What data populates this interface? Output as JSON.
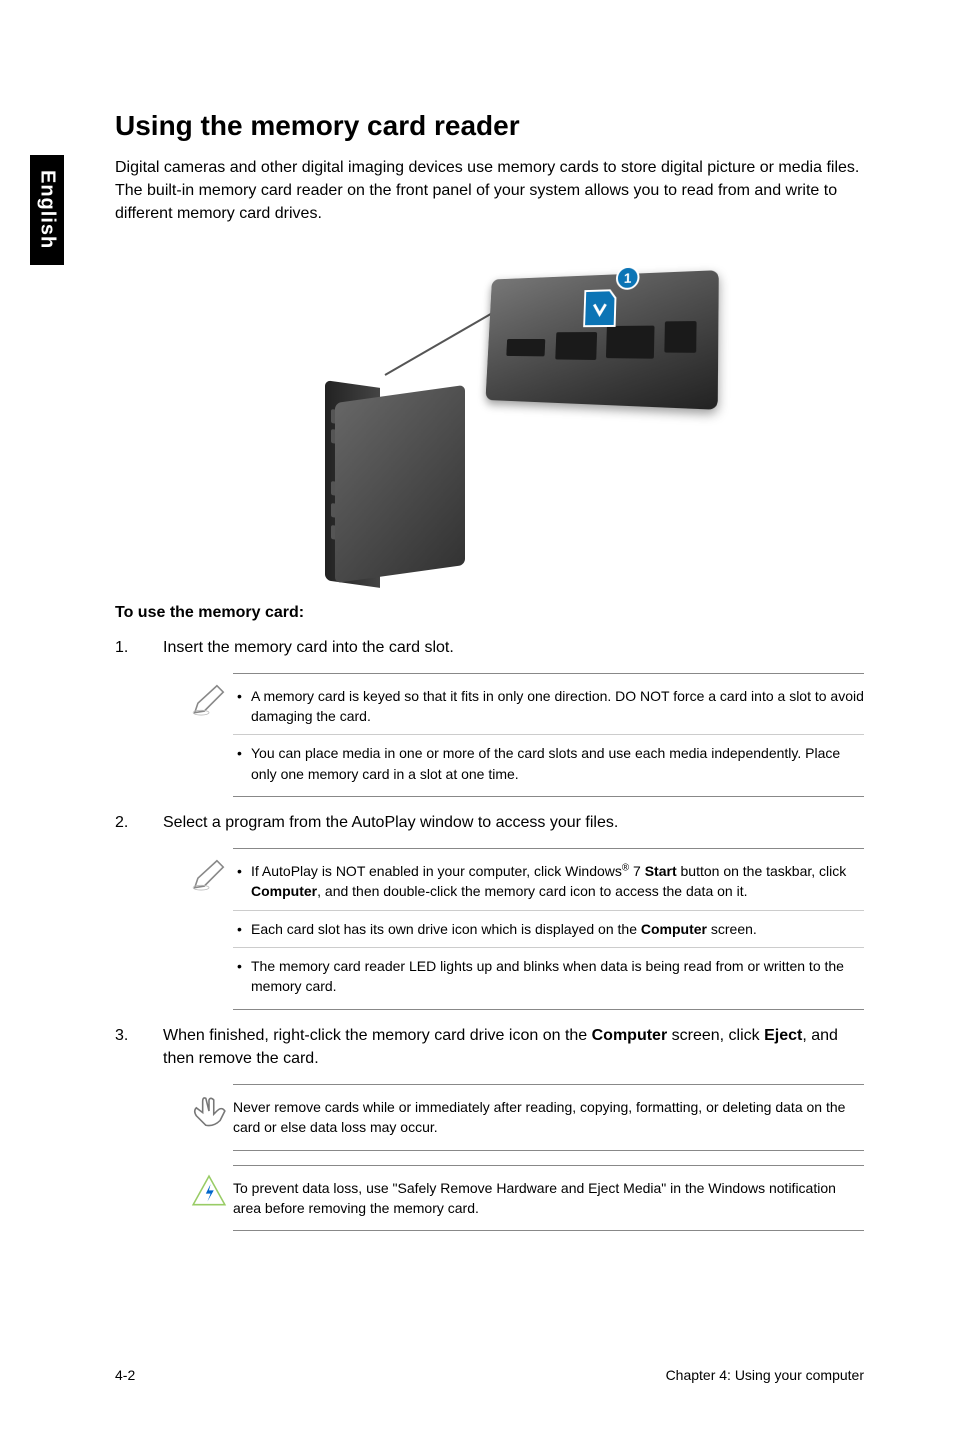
{
  "lang_tab": "English",
  "heading": "Using the memory card reader",
  "intro": "Digital cameras and other digital imaging devices use memory cards to store digital picture or media files. The built-in memory card reader on the front panel of your system allows you to read from and write to different memory card drives.",
  "figure": {
    "callout_badge": "1"
  },
  "steps_heading": "To use the memory card:",
  "steps": {
    "s1": {
      "num": "1.",
      "text": "Insert the memory card into the card slot."
    },
    "s2": {
      "num": "2.",
      "text": "Select a program from the AutoPlay window to access your files."
    },
    "s3": {
      "num": "3.",
      "pre": "When finished, right-click the memory card drive icon on the ",
      "bold1": "Computer",
      "mid": " screen, click ",
      "bold2": "Eject",
      "post": ", and then remove the card."
    }
  },
  "note1": {
    "b1": "A memory card is keyed so that it fits in only one direction. DO NOT force a card into a slot to avoid damaging the card.",
    "b2": "You can place media in one or more of the card slots and use each media independently. Place only one memory card in a slot at one time."
  },
  "note2": {
    "b1_pre": "If AutoPlay is NOT enabled in your computer, click Windows",
    "b1_sup": "®",
    "b1_mid1": " 7 ",
    "b1_bold1": "Start",
    "b1_mid2": " button on the taskbar, click ",
    "b1_bold2": "Computer",
    "b1_post": ", and then double-click the memory card icon to access the data on it.",
    "b2_pre": "Each card slot has its own drive icon which is displayed on the ",
    "b2_bold": "Computer",
    "b2_post": " screen.",
    "b3": "The memory card reader LED lights up and blinks when data is being read from or written to the memory card."
  },
  "note3": "Never remove cards while or immediately after reading, copying, formatting, or deleting data on the card or else data loss may occur.",
  "note4": "To prevent data loss, use \"Safely Remove Hardware and Eject Media\" in the Windows notification area before removing the memory card.",
  "footer": {
    "left": "4-2",
    "right": "Chapter 4: Using your computer"
  }
}
